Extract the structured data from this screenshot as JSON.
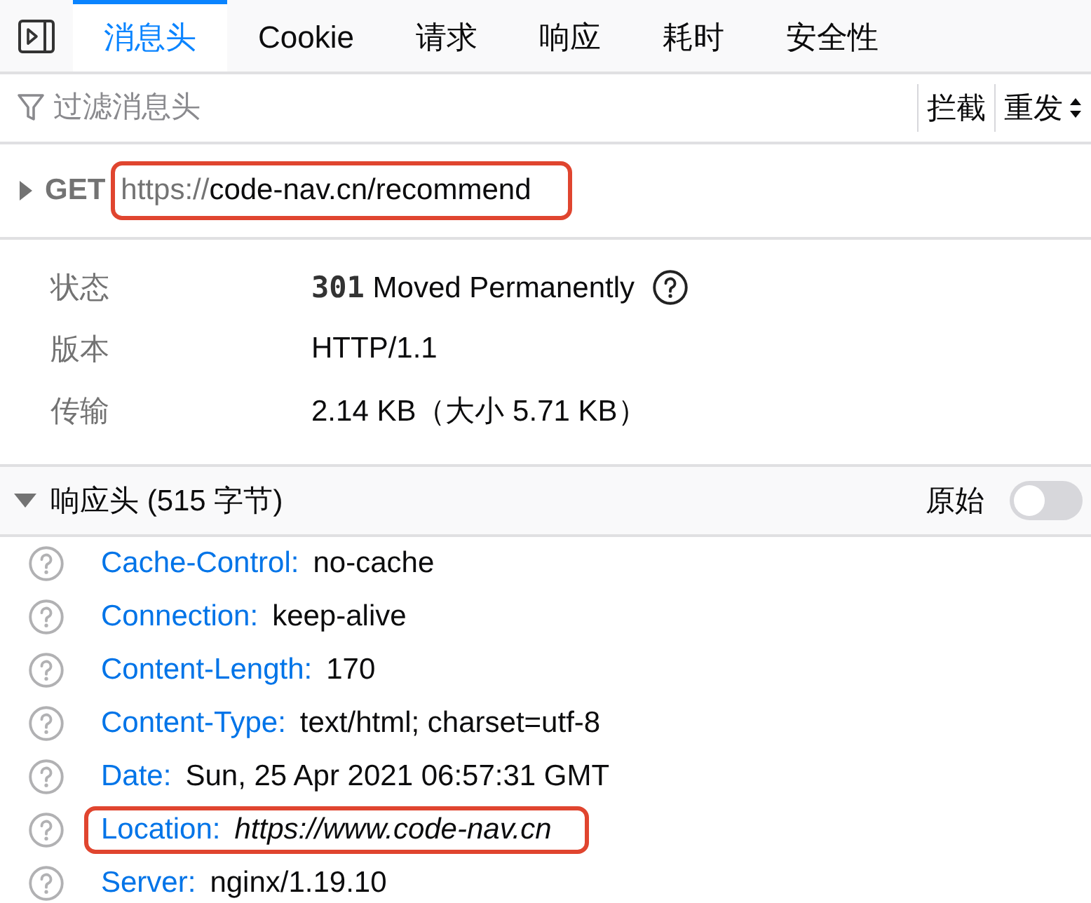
{
  "tabs": [
    {
      "label": "消息头",
      "selected": true
    },
    {
      "label": "Cookie",
      "selected": false
    },
    {
      "label": "请求",
      "selected": false
    },
    {
      "label": "响应",
      "selected": false
    },
    {
      "label": "耗时",
      "selected": false
    },
    {
      "label": "安全性",
      "selected": false
    }
  ],
  "filter": {
    "placeholder": "过滤消息头"
  },
  "toolbar_buttons": [
    "拦截",
    "重发"
  ],
  "request": {
    "method": "GET",
    "url_scheme": "https://",
    "url_rest": "code-nav.cn/recommend",
    "expanded": false,
    "highlighted": true
  },
  "summary": [
    {
      "label": "状态",
      "value": "**301** Moved Permanently",
      "help": true
    },
    {
      "label": "版本",
      "value": "HTTP/1.1",
      "help": false
    },
    {
      "label": "传输",
      "value": "2.14 KB（大小 5.71 KB）",
      "help": false
    }
  ],
  "response_headers": {
    "title": "响应头 (515 字节)",
    "expanded": true,
    "raw_label": "原始",
    "raw_on": false,
    "headers": [
      {
        "name": "Cache-Control:",
        "value": "no-cache",
        "highlighted": false,
        "italic": false
      },
      {
        "name": "Connection:",
        "value": "keep-alive",
        "highlighted": false,
        "italic": false
      },
      {
        "name": "Content-Length:",
        "value": "170",
        "highlighted": false,
        "italic": false
      },
      {
        "name": "Content-Type:",
        "value": "text/html; charset=utf-8",
        "highlighted": false,
        "italic": false
      },
      {
        "name": "Date:",
        "value": "Sun, 25 Apr 2021 06:57:31 GMT",
        "highlighted": false,
        "italic": false
      },
      {
        "name": "Location:",
        "value": "https://www.code-nav.cn",
        "highlighted": true,
        "italic": true
      },
      {
        "name": "Server:",
        "value": "nginx/1.19.10",
        "highlighted": false,
        "italic": false
      }
    ]
  }
}
